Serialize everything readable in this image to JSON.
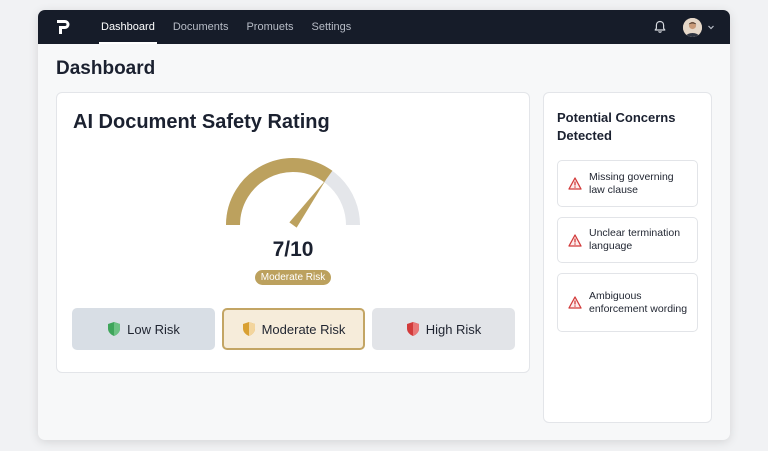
{
  "nav": {
    "items": [
      {
        "label": "Dashboard",
        "active": true
      },
      {
        "label": "Documents",
        "active": false
      },
      {
        "label": "Promuets",
        "active": false
      },
      {
        "label": "Settings",
        "active": false
      }
    ]
  },
  "icons": {
    "logo": "p-logo-icon",
    "bell": "bell-icon",
    "avatar": "user-avatar",
    "caret": "chevron-down-icon",
    "warning": "warning-triangle-icon",
    "shield": "shield-icon"
  },
  "page": {
    "title": "Dashboard"
  },
  "rating": {
    "title": "AI Document Safety Rating",
    "score_text": "7/10",
    "score": 7,
    "max": 10,
    "level_label": "Moderate Risk",
    "gauge_fill_fraction": 0.7
  },
  "risk_levels": [
    {
      "label": "Low Risk",
      "color": "#3fa55b",
      "selected": false
    },
    {
      "label": "Moderate Risk",
      "color": "#d9a032",
      "selected": true
    },
    {
      "label": "High Risk",
      "color": "#d23b3b",
      "selected": false
    }
  ],
  "concerns": {
    "title": "Potential Concerns Detected",
    "items": [
      {
        "text": "Missing governing law clause"
      },
      {
        "text": "Unclear termination language"
      },
      {
        "text": "Ambiguous enforcement wording"
      }
    ]
  },
  "colors": {
    "accent_gold": "#bca15e",
    "topbar": "#161c29",
    "warning": "#d23b3b"
  }
}
